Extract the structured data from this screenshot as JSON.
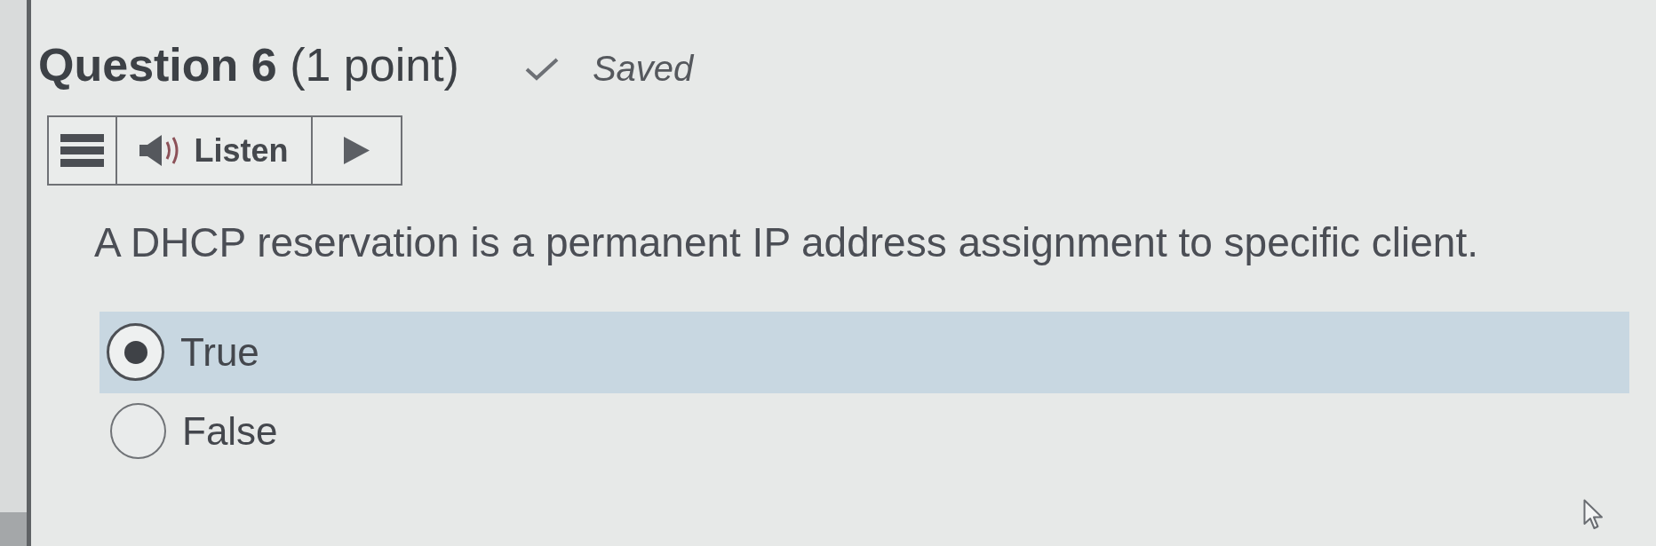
{
  "question": {
    "title": "**Question 6** (1 point)",
    "saved": true,
    "status": "Saved"
  },
  "toolbar": {
    "listen_label": "Listen"
  },
  "prompt": "A DHCP reservation is a permanent IP address assignment to specific client.",
  "options": [
    {
      "label": "True",
      "selected": true
    },
    {
      "label": "False",
      "selected": false
    }
  ]
}
